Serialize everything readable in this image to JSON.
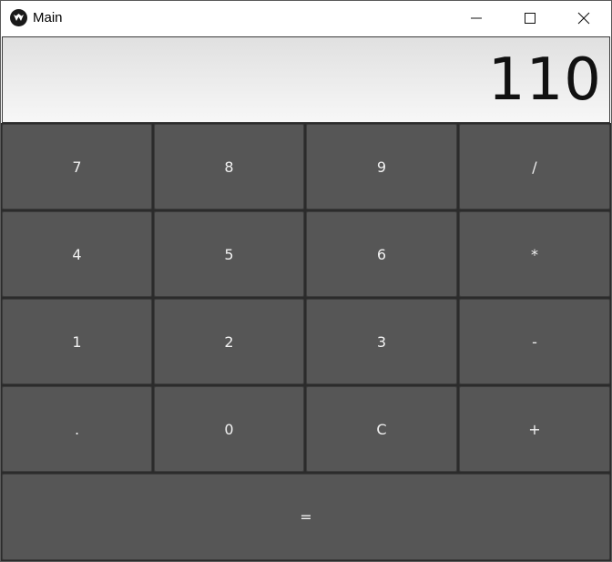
{
  "window": {
    "title": "Main",
    "icon": "kivy-logo-icon",
    "controls": [
      "minimize-icon",
      "maximize-icon",
      "close-icon"
    ]
  },
  "display": {
    "value": "110"
  },
  "keys": {
    "k7": "7",
    "k8": "8",
    "k9": "9",
    "divide": "/",
    "k4": "4",
    "k5": "5",
    "k6": "6",
    "multiply": "*",
    "k1": "1",
    "k2": "2",
    "k3": "3",
    "subtract": "-",
    "decimal": ".",
    "k0": "0",
    "clear": "C",
    "add": "+",
    "equals": "="
  },
  "colors": {
    "key_bg": "#565656",
    "key_text": "#f2f2f2",
    "display_bg": "#efefef",
    "display_text": "#111111"
  }
}
